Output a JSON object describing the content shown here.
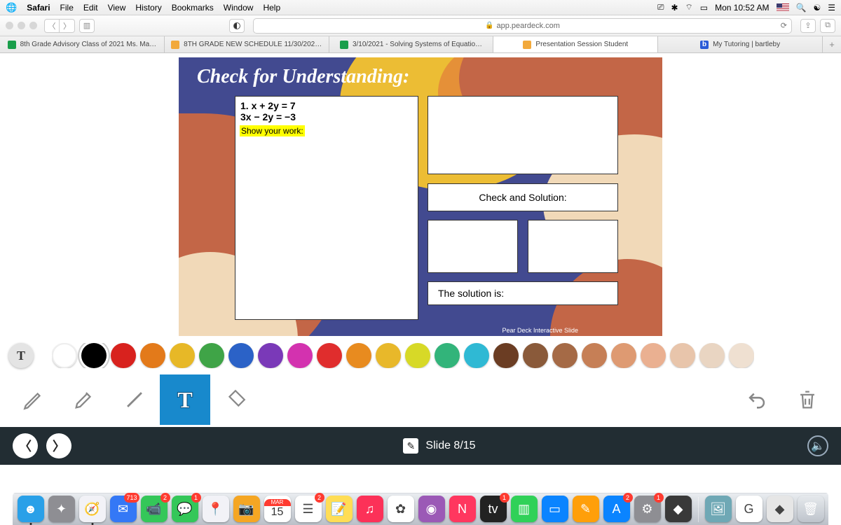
{
  "menubar": {
    "app": "Safari",
    "items": [
      "File",
      "Edit",
      "View",
      "History",
      "Bookmarks",
      "Window",
      "Help"
    ],
    "clock": "Mon 10:52 AM"
  },
  "toolbar": {
    "url": "app.peardeck.com"
  },
  "tabs": [
    {
      "label": "8th Grade Advisory Class of 2021 Ms. Ma…",
      "faviconColor": "#1a9e4b"
    },
    {
      "label": "8TH GRADE NEW SCHEDULE 11/30/202…",
      "faviconColor": "#f2a93b"
    },
    {
      "label": "3/10/2021 - Solving Systems of Equatio…",
      "faviconColor": "#1a9e4b"
    },
    {
      "label": "Presentation Session Student",
      "faviconColor": "#f2a93b",
      "active": true
    },
    {
      "label": "My Tutoring | bartleby",
      "faviconColor": "#2a5bd7",
      "faviconText": "b"
    }
  ],
  "slide": {
    "title": "Check for Understanding:",
    "eq1": "1. x + 2y = 7",
    "eq2": "    3x − 2y = −3",
    "showwork": "Show your work:",
    "checksol": "Check and Solution:",
    "solution": "The solution is:",
    "footer": "Pear Deck Interactive Slide"
  },
  "palette": [
    "#ffffff",
    "#000000",
    "#d8221e",
    "#e37a1a",
    "#e7b827",
    "#3fa447",
    "#2b62c7",
    "#7a39b8",
    "#d332af",
    "#e02d2d",
    "#e88b1f",
    "#e8b82a",
    "#d7d927",
    "#32b47a",
    "#2fb9d4",
    "#6b3d23",
    "#8a5a3a",
    "#a56a46",
    "#c67f56",
    "#de9a72",
    "#eab091",
    "#e8c5ab",
    "#e9d5c2",
    "#efe0d1"
  ],
  "paletteSelected": 1,
  "tools": {
    "active": "text"
  },
  "slideNav": {
    "label": "Slide 8/15"
  },
  "dock": {
    "cal": {
      "month": "MAR",
      "day": "15"
    },
    "items": [
      {
        "name": "finder",
        "bg": "#29a0e8",
        "glyph": "☻",
        "dot": true
      },
      {
        "name": "launchpad",
        "bg": "#8e8e93",
        "glyph": "✦"
      },
      {
        "name": "safari",
        "bg": "#f2f2f7",
        "glyph": "🧭",
        "dot": true
      },
      {
        "name": "mail",
        "bg": "#3478f6",
        "glyph": "✉",
        "badge": "713"
      },
      {
        "name": "facetime",
        "bg": "#34c759",
        "glyph": "📹",
        "badge": "2"
      },
      {
        "name": "messages",
        "bg": "#34c759",
        "glyph": "💬",
        "badge": "1"
      },
      {
        "name": "maps",
        "bg": "#f2f2f7",
        "glyph": "📍"
      },
      {
        "name": "photobooth",
        "bg": "#f5a623",
        "glyph": "📷"
      },
      {
        "name": "calendar",
        "bg": "#ffffff"
      },
      {
        "name": "reminders",
        "bg": "#ffffff",
        "glyph": "☰",
        "badge": "2"
      },
      {
        "name": "notes",
        "bg": "#ffdd55",
        "glyph": "📝"
      },
      {
        "name": "music",
        "bg": "#fc3158",
        "glyph": "♫"
      },
      {
        "name": "photos",
        "bg": "#ffffff",
        "glyph": "✿"
      },
      {
        "name": "podcasts",
        "bg": "#9b59b6",
        "glyph": "◉"
      },
      {
        "name": "news",
        "bg": "#ff375f",
        "glyph": "N"
      },
      {
        "name": "appletv",
        "bg": "#222222",
        "glyph": "tv",
        "badge": "1"
      },
      {
        "name": "numbers",
        "bg": "#30d158",
        "glyph": "▥"
      },
      {
        "name": "keynote",
        "bg": "#0a84ff",
        "glyph": "▭"
      },
      {
        "name": "pages",
        "bg": "#ff9f0a",
        "glyph": "✎"
      },
      {
        "name": "appstore",
        "bg": "#0a84ff",
        "glyph": "A",
        "badge": "2"
      },
      {
        "name": "preferences",
        "bg": "#8e8e93",
        "glyph": "⚙",
        "badge": "1"
      },
      {
        "name": "roblox",
        "bg": "#393939",
        "glyph": "◆"
      }
    ],
    "right": [
      {
        "name": "desktop-pic",
        "bg": "#6fa8b5",
        "glyph": "🖼"
      },
      {
        "name": "goguardian",
        "bg": "#ffffff",
        "glyph": "G"
      },
      {
        "name": "roblox2",
        "bg": "#e6e6e6",
        "glyph": "◆"
      },
      {
        "name": "trash",
        "bg": "none",
        "glyph": "🗑"
      }
    ]
  }
}
